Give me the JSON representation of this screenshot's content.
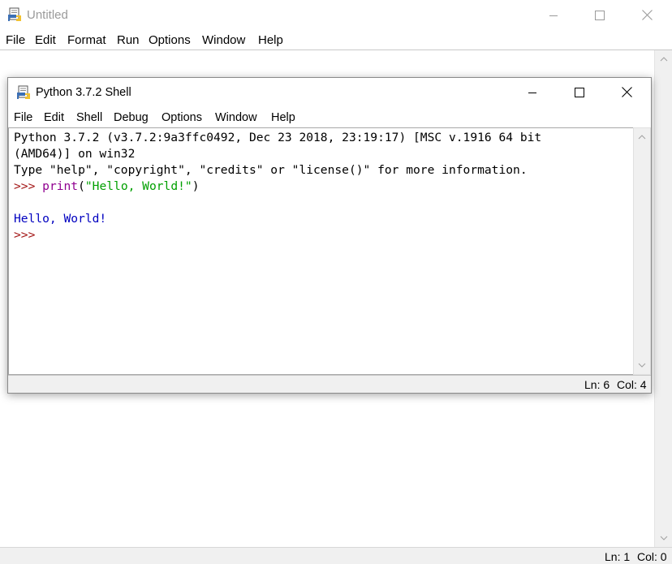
{
  "editor_window": {
    "title": "Untitled",
    "menu": [
      "File",
      "Edit",
      "Format",
      "Run",
      "Options",
      "Window",
      "Help"
    ],
    "status": {
      "line": "Ln: 1",
      "col": "Col: 0"
    }
  },
  "shell_window": {
    "title": "Python 3.7.2 Shell",
    "menu": [
      "File",
      "Edit",
      "Shell",
      "Debug",
      "Options",
      "Window",
      "Help"
    ],
    "text": {
      "banner_line1": "Python 3.7.2 (v3.7.2:9a3ffc0492, Dec 23 2018, 23:19:17) [MSC v.1916 64 bit",
      "banner_line2": "(AMD64)] on win32",
      "banner_line3": "Type \"help\", \"copyright\", \"credits\" or \"license()\" for more information.",
      "prompt": ">>> ",
      "command_func": "print",
      "command_open": "(",
      "command_string": "\"Hello, World!\"",
      "command_close": ")",
      "output": "Hello, World!",
      "prompt2": ">>>"
    },
    "status": {
      "line": "Ln: 6",
      "col": "Col: 4"
    }
  },
  "icons": {
    "app": "python-idle-icon",
    "minimize": "minimize-icon",
    "maximize": "maximize-icon",
    "close": "close-icon",
    "scroll_up": "chevron-up-icon",
    "scroll_down": "chevron-down-icon"
  },
  "colors": {
    "prompt": "#a31515",
    "builtin": "#900090",
    "string": "#00a000",
    "output": "#0000c0",
    "inactive_title": "#9a9a9a"
  }
}
